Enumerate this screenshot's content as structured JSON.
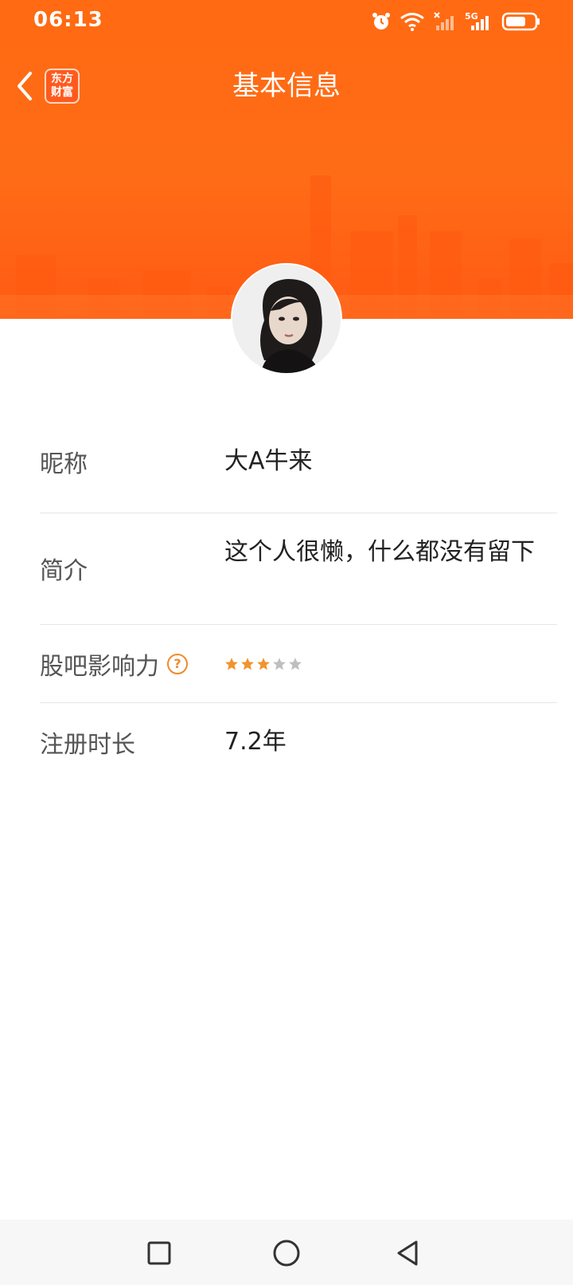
{
  "status_bar": {
    "time": "06:13",
    "icons": [
      "alarm-icon",
      "wifi-icon",
      "signal-no-sim-icon",
      "signal-5g-icon",
      "battery-icon"
    ],
    "network_label": "5G"
  },
  "header": {
    "title": "基本信息",
    "back_icon": "chevron-left-icon",
    "logo_text_line1": "东方",
    "logo_text_line2": "财富",
    "accent_color": "#ff6a12"
  },
  "profile": {
    "avatar": "user-avatar-photo"
  },
  "info": {
    "rows": [
      {
        "label": "昵称",
        "value": "大A牛来"
      },
      {
        "label": "简介",
        "value": "这个人很懒，什么都没有留下"
      },
      {
        "label": "股吧影响力",
        "help_icon": "question-circle-icon",
        "help_glyph": "?",
        "stars": {
          "filled": 3,
          "total": 5
        }
      },
      {
        "label": "注册时长",
        "value": "7.2年"
      }
    ]
  },
  "system_nav": {
    "buttons": [
      "recents-square-icon",
      "home-circle-icon",
      "back-triangle-icon"
    ]
  },
  "colors": {
    "star_filled": "#f0942e",
    "star_empty": "#bfbfbf",
    "label_text": "#555555",
    "value_text": "#222222"
  }
}
